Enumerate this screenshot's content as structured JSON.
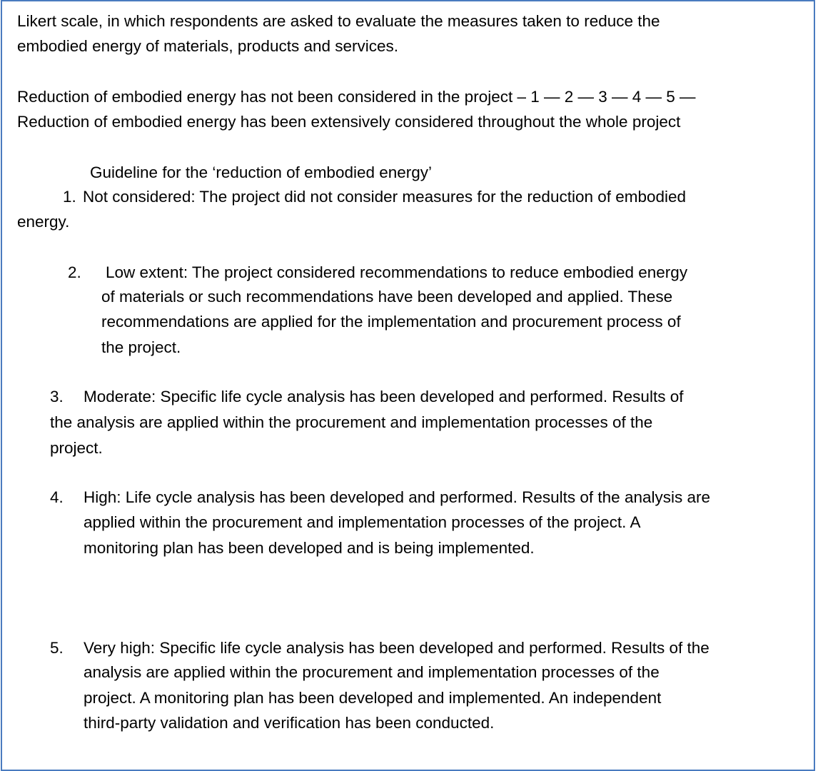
{
  "intro": {
    "line1": "Likert scale, in which respondents are asked to evaluate the measures taken to reduce the",
    "line2": "embodied energy of materials, products and services."
  },
  "scale": {
    "line1": "Reduction of embodied energy has not been considered in the project – 1 — 2 — 3 — 4 — 5 —",
    "line2": "Reduction of embodied energy has been extensively considered throughout the whole project"
  },
  "guideline": {
    "title": "Guideline for the ‘reduction of embodied energy’",
    "items": [
      {
        "number": "1.",
        "lines": [
          "Not considered: The project did not consider measures for the reduction of embodied",
          "energy."
        ]
      },
      {
        "number": "2.",
        "lines": [
          "Low extent: The project considered recommendations to reduce embodied energy",
          "of materials or such recommendations have been developed and applied. These",
          "recommendations are applied for the implementation and procurement process of",
          "the project."
        ]
      },
      {
        "number": "3.",
        "lines": [
          "Moderate: Specific life cycle analysis has been developed and performed. Results of",
          "the analysis are applied within the procurement and implementation processes of the",
          "project."
        ]
      },
      {
        "number": "4.",
        "lines": [
          "High: Life cycle analysis has been developed and performed. Results of the analysis are",
          "applied within the procurement and implementation processes of the project. A",
          "monitoring plan has been developed and is being implemented."
        ]
      },
      {
        "number": "5.",
        "lines": [
          "Very high: Specific life cycle analysis has been developed and performed. Results of the",
          "analysis are applied within the procurement and implementation processes of the",
          "project. A monitoring plan has been developed and implemented. An independent",
          "third-party validation and verification has been conducted."
        ]
      }
    ]
  }
}
